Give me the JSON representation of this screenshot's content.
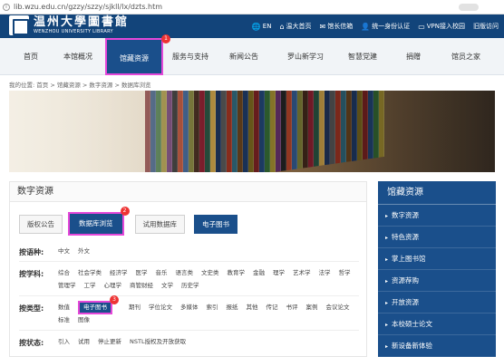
{
  "address_bar": {
    "url": "lib.wzu.edu.cn/gzzy/szzy/sjkll/lx/dzts.htm"
  },
  "header": {
    "logo_cn": "温州大學圖書館",
    "logo_en": "WENZHOU UNIVERSITY LIBRARY",
    "links": [
      {
        "icon": "globe-icon",
        "glyph": "🌐",
        "label": "EN"
      },
      {
        "icon": "home-icon",
        "glyph": "⌂",
        "label": "温大首页"
      },
      {
        "icon": "mail-icon",
        "glyph": "✉",
        "label": "馆长信箱"
      },
      {
        "icon": "user-icon",
        "glyph": "👤",
        "label": "统一身份认证"
      },
      {
        "icon": "screen-icon",
        "glyph": "▭",
        "label": "VPN接入校园"
      },
      {
        "icon": "",
        "glyph": "",
        "label": "旧版访问"
      }
    ]
  },
  "nav": {
    "items": [
      "首页",
      "本馆概况",
      "馆藏资源",
      "服务与支持",
      "新闻公告",
      "罗山新学习",
      "智慧党建",
      "捐赠",
      "馆员之家"
    ],
    "active_index": 2,
    "badge": "1"
  },
  "breadcrumb": "我的位置: 首页 > 馆藏资源 > 数字资源 > 数据库浏览",
  "main": {
    "title": "数字资源",
    "tabs": [
      "版权公告",
      "数据库浏览",
      "试用数据库",
      "电子图书"
    ],
    "tab_badge": "2",
    "filters": [
      {
        "label": "按语种:",
        "options": [
          "中文",
          "外文"
        ]
      },
      {
        "label": "按学科:",
        "options": [
          "综合",
          "社会学类",
          "经济学",
          "医学",
          "音乐",
          "语言类",
          "文史类",
          "教育学",
          "金融",
          "理学",
          "艺术学",
          "法学",
          "哲学",
          "管理学",
          "工学",
          "心理学",
          "商管财经",
          "文学",
          "历史学"
        ]
      },
      {
        "label": "按类型:",
        "options": [
          "电子图书",
          "期刊",
          "学位论文",
          "多媒体",
          "索引",
          "报纸",
          "其他",
          "传记",
          "书评",
          "案例",
          "会议论文",
          "标准",
          "图像"
        ],
        "active_index": 0,
        "badge": "3"
      },
      {
        "label": "按状态:",
        "options": [
          "引入",
          "试用",
          "停止更新",
          "NSTL授权及开放获取"
        ]
      }
    ],
    "extra_type_label": "数值"
  },
  "sidebar": {
    "title": "馆藏资源",
    "items": [
      "数字资源",
      "特色资源",
      "掌上图书馆",
      "资源荐购",
      "开放资源",
      "本校硕士论文",
      "新设备新体验"
    ]
  },
  "colors": {
    "primary": "#1a4f8b",
    "header": "#12447a",
    "highlight": "#e548d9",
    "badge": "#e33333"
  }
}
